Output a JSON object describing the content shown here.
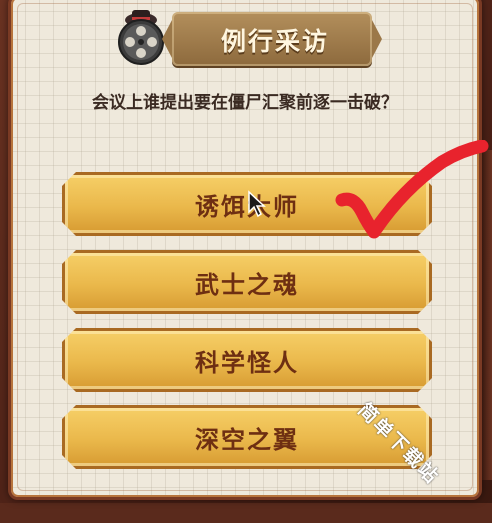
{
  "header": {
    "title": "例行采访",
    "icon": "film-reel-icon"
  },
  "question": "会议上谁提出要在僵尸汇聚前逐一击破？",
  "options": [
    {
      "label": "诱饵大师"
    },
    {
      "label": "武士之魂"
    },
    {
      "label": "科学怪人"
    },
    {
      "label": "深空之翼"
    }
  ],
  "watermark": "简单下载站",
  "colors": {
    "option_fill": "#eab84b",
    "option_text": "#6e2f12",
    "paper": "#efe9dc",
    "check": "#e8232d"
  }
}
